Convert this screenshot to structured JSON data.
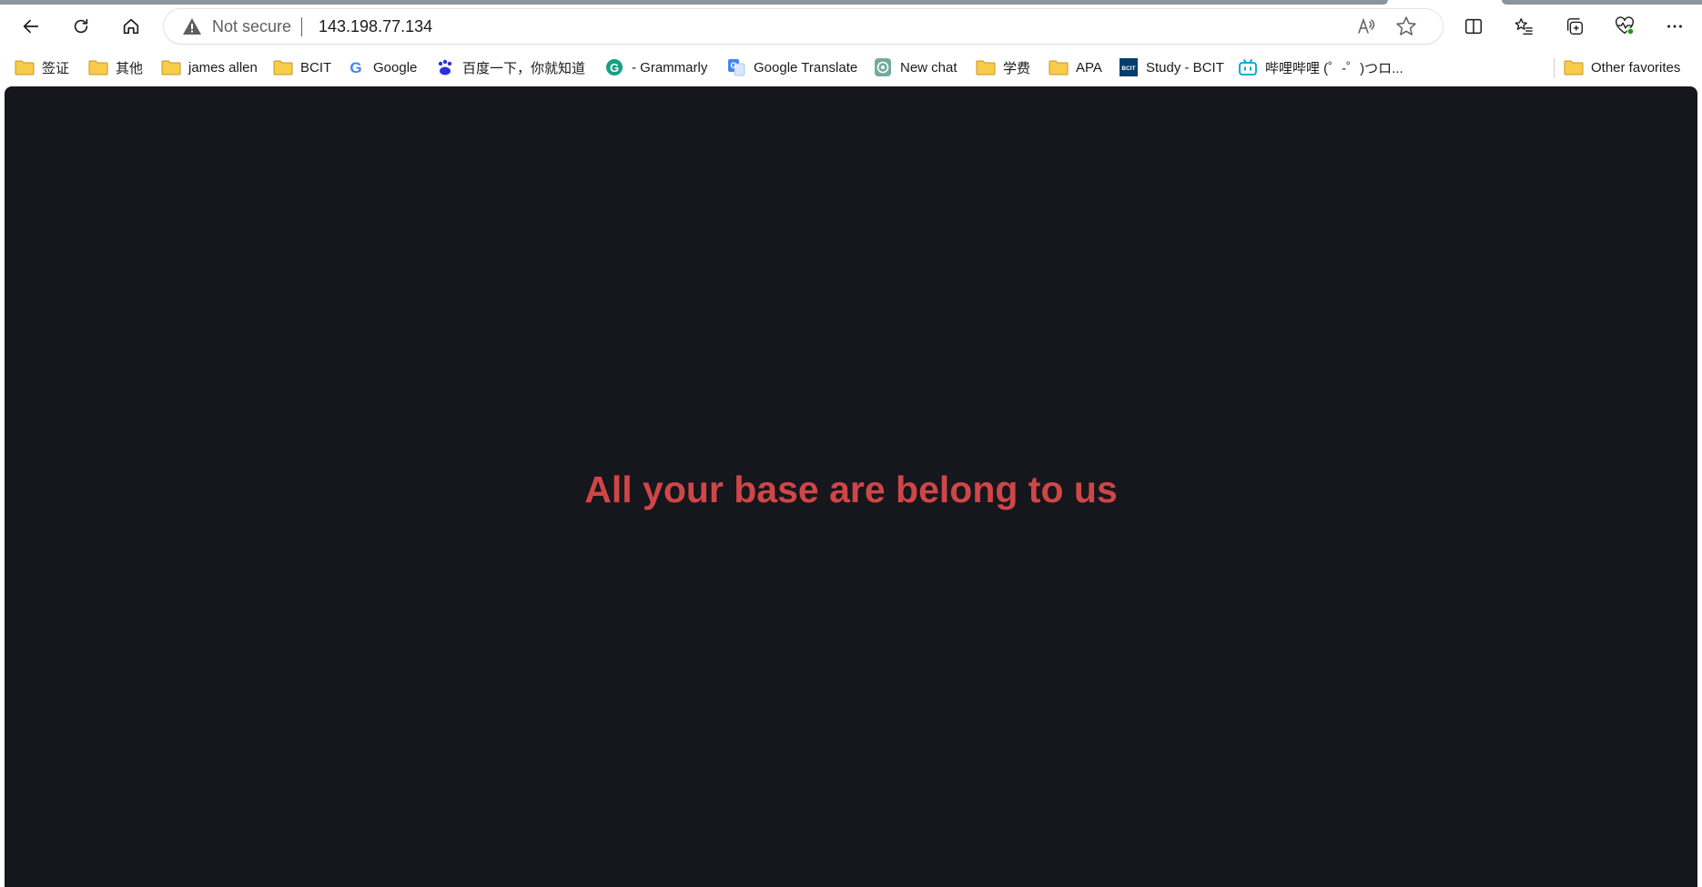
{
  "browser": {
    "toolbar": {
      "back_icon": "back-arrow-icon",
      "refresh_icon": "refresh-icon",
      "home_icon": "home-icon",
      "split_screen_icon": "split-screen-icon",
      "favorites_icon": "favorites-list-icon",
      "collections_icon": "collections-icon",
      "performance_icon": "heartbeat-icon",
      "more_icon": "more-icon"
    },
    "address_bar": {
      "security_label": "Not secure",
      "url": "143.198.77.134",
      "read_aloud_icon": "read-aloud-icon",
      "favorite_icon": "star-icon"
    },
    "bookmarks": [
      {
        "label": "签证",
        "icon": "folder-icon"
      },
      {
        "label": "其他",
        "icon": "folder-icon"
      },
      {
        "label": "james allen",
        "icon": "folder-icon"
      },
      {
        "label": "BCIT",
        "icon": "folder-icon"
      },
      {
        "label": "Google",
        "icon": "google-icon"
      },
      {
        "label": "百度一下，你就知道",
        "icon": "baidu-icon"
      },
      {
        "label": "- Grammarly",
        "icon": "grammarly-icon"
      },
      {
        "label": "Google Translate",
        "icon": "google-translate-icon"
      },
      {
        "label": "New chat",
        "icon": "chatgpt-icon"
      },
      {
        "label": "学费",
        "icon": "folder-icon"
      },
      {
        "label": "APA",
        "icon": "folder-icon"
      },
      {
        "label": "Study - BCIT",
        "icon": "bcit-icon"
      },
      {
        "label": "哔哩哔哩 (゜-゜)つロ...",
        "icon": "bilibili-icon"
      }
    ],
    "other_favorites": {
      "label": "Other favorites",
      "icon": "folder-icon"
    }
  },
  "page": {
    "headline": "All your base are belong to us",
    "background_color": "#16161d",
    "headline_color": "#cf4647"
  },
  "colors": {
    "folder": "#f8cc4a",
    "grammarly": "#15a085",
    "bcit": "#003e6b",
    "bilibili": "#00a1d6",
    "baidu": "#2932e1"
  }
}
